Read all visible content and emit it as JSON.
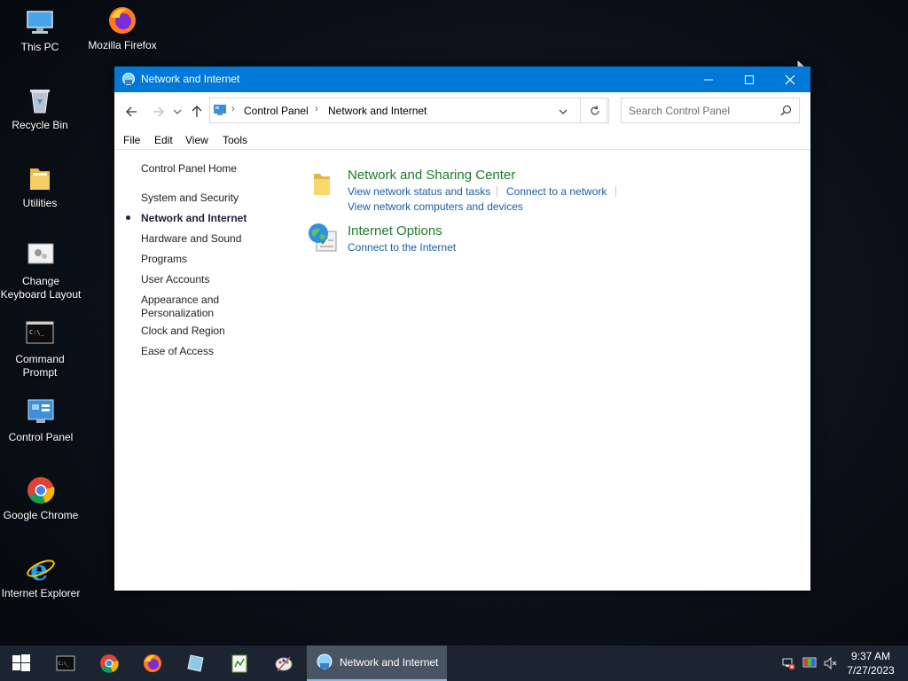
{
  "desktop": {
    "icons": [
      {
        "label": "This PC",
        "icon": "computer-icon"
      },
      {
        "label": "Mozilla Firefox",
        "icon": "firefox-icon"
      },
      {
        "label": "Recycle Bin",
        "icon": "recycle-bin-icon"
      },
      {
        "label": "Utilities",
        "icon": "folder-icon"
      },
      {
        "label": "Change Keyboard Layout",
        "icon": "keyboard-settings-icon"
      },
      {
        "label": "Command Prompt",
        "icon": "command-prompt-icon"
      },
      {
        "label": "Control Panel",
        "icon": "control-panel-icon"
      },
      {
        "label": "Google Chrome",
        "icon": "chrome-icon"
      },
      {
        "label": "Internet Explorer",
        "icon": "internet-explorer-icon"
      }
    ]
  },
  "window": {
    "title": "Network and Internet",
    "address": {
      "crumbs": [
        "Control Panel",
        "Network and Internet"
      ]
    },
    "search": {
      "placeholder": "Search Control Panel"
    },
    "menu": [
      "File",
      "Edit",
      "View",
      "Tools"
    ],
    "left_nav": {
      "home": "Control Panel Home",
      "items": [
        "System and Security",
        "Network and Internet",
        "Hardware and Sound",
        "Programs",
        "User Accounts",
        "Appearance and Personalization",
        "Clock and Region",
        "Ease of Access"
      ],
      "active_index": 1
    },
    "categories": [
      {
        "title": "Network and Sharing Center",
        "links": [
          "View network status and tasks",
          "Connect to a network",
          "View network computers and devices"
        ]
      },
      {
        "title": "Internet Options",
        "links": [
          "Connect to the Internet"
        ]
      }
    ]
  },
  "taskbar": {
    "active_label": "Network and Internet",
    "clock": {
      "time": "9:37 AM",
      "date": "7/27/2023"
    }
  },
  "colors": {
    "titlebar": "#0078d7",
    "category_title": "#1e7b2d",
    "link": "#1a5ea8",
    "taskbar": "#1b2430"
  }
}
